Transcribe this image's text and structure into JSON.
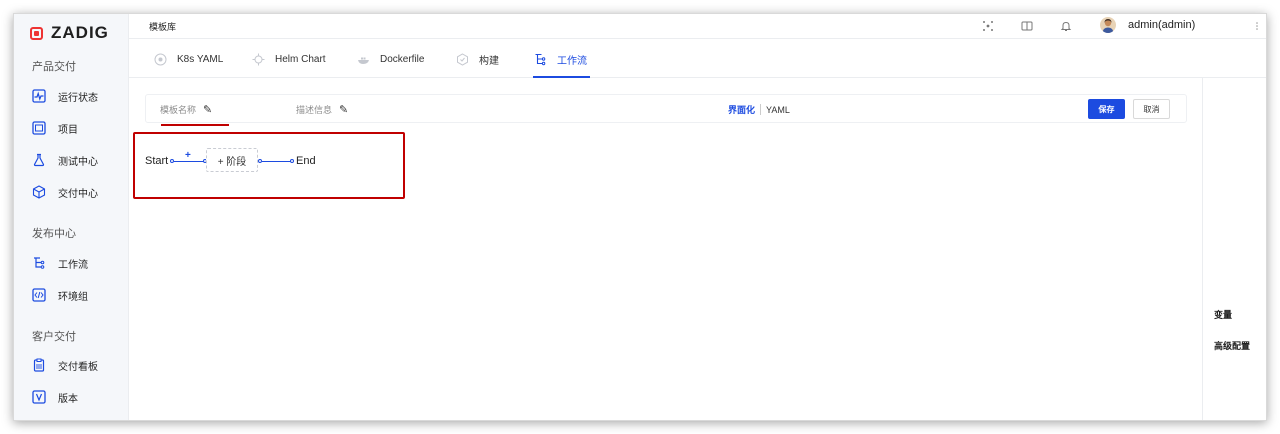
{
  "app": {
    "logo_text": "ZADIG",
    "brand_color": "#e33333",
    "accent_color": "#1c4be0"
  },
  "sidebar": {
    "groups": [
      {
        "label": "产品交付",
        "items": [
          {
            "label": "运行状态",
            "icon": "pulse-icon"
          },
          {
            "label": "项目",
            "icon": "project-icon"
          },
          {
            "label": "测试中心",
            "icon": "flask-icon"
          },
          {
            "label": "交付中心",
            "icon": "package-icon"
          }
        ]
      },
      {
        "label": "发布中心",
        "items": [
          {
            "label": "工作流",
            "icon": "workflow-icon"
          },
          {
            "label": "环境组",
            "icon": "code-icon"
          }
        ]
      },
      {
        "label": "客户交付",
        "items": [
          {
            "label": "交付看板",
            "icon": "clipboard-icon"
          },
          {
            "label": "版本",
            "icon": "version-icon"
          }
        ]
      }
    ]
  },
  "topbar": {
    "breadcrumb": "模板库",
    "user": "admin(admin)"
  },
  "tabs": [
    {
      "label": "K8s YAML",
      "icon": "k8s-icon",
      "active": false
    },
    {
      "label": "Helm Chart",
      "icon": "helm-icon",
      "active": false
    },
    {
      "label": "Dockerfile",
      "icon": "docker-icon",
      "active": false
    },
    {
      "label": "构建",
      "icon": "build-icon",
      "active": false
    },
    {
      "label": "工作流",
      "icon": "workflow-icon",
      "active": true
    }
  ],
  "editor": {
    "template_name_placeholder": "模板名称",
    "description_placeholder": "描述信息",
    "mode_ui": "界面化",
    "mode_yaml": "YAML",
    "save_label": "保存",
    "cancel_label": "取消"
  },
  "workflow": {
    "start_label": "Start",
    "end_label": "End",
    "add_marker": "+",
    "add_stage_label": "+ 阶段"
  },
  "right_panel": {
    "items": [
      "变量",
      "高级配置"
    ]
  }
}
